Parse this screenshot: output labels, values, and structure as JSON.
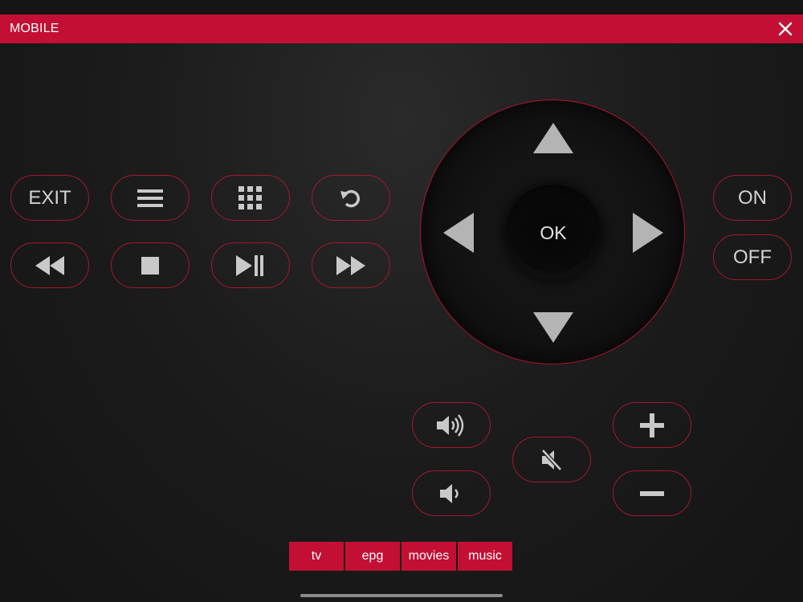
{
  "app": {
    "title": "MOBILE"
  },
  "buttons": {
    "exit_label": "EXIT",
    "on_label": "ON",
    "off_label": "OFF",
    "ok_label": "OK"
  },
  "icons": {
    "close": "close-icon",
    "menu": "menu-icon",
    "grid": "grid-icon",
    "refresh": "refresh-icon",
    "rewind": "rewind-icon",
    "stop": "stop-icon",
    "play_pause": "play-pause-icon",
    "fast_forward": "fast-forward-icon",
    "volume_up": "volume-up-icon",
    "volume_down": "volume-down-icon",
    "mute": "mute-icon",
    "plus": "plus-icon",
    "minus": "minus-icon",
    "arrow_up": "arrow-up-icon",
    "arrow_down": "arrow-down-icon",
    "arrow_left": "arrow-left-icon",
    "arrow_right": "arrow-right-icon"
  },
  "tabs": [
    {
      "label": "tv"
    },
    {
      "label": "epg"
    },
    {
      "label": "movies"
    },
    {
      "label": "music"
    }
  ],
  "colors": {
    "accent": "#c30f34",
    "button_border": "#a3182f",
    "icon": "#c9c9c9",
    "background": "#1c1c1c"
  }
}
